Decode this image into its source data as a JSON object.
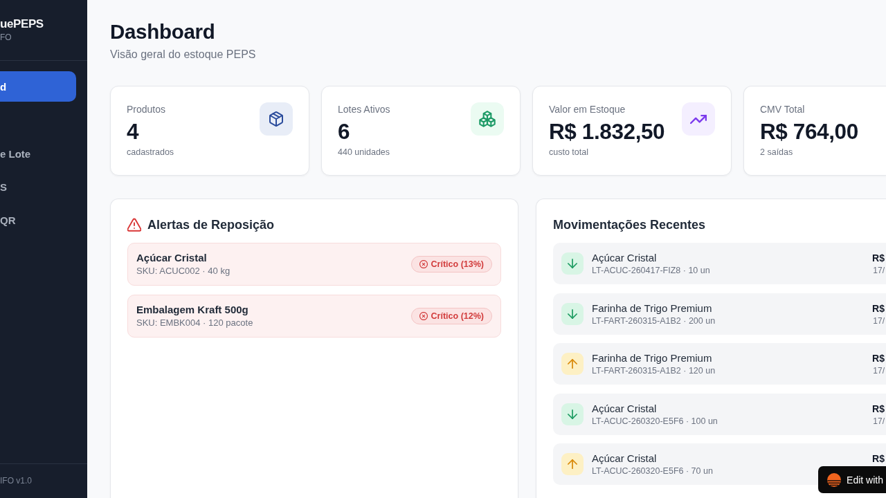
{
  "sidebar": {
    "logo_title": "uePEPS",
    "logo_subtitle": "FO",
    "nav": [
      {
        "label": "d",
        "selected": true
      },
      {
        "label": "e Lote",
        "selected": false
      },
      {
        "label": "S",
        "selected": false
      },
      {
        "label": "QR",
        "selected": false
      }
    ],
    "version": "IFO v1.0"
  },
  "header": {
    "title": "Dashboard",
    "subtitle": "Visão geral do estoque PEPS"
  },
  "stats": [
    {
      "kind": "products",
      "label": "Produtos",
      "value": "4",
      "caption": "cadastrados"
    },
    {
      "kind": "batches",
      "label": "Lotes Ativos",
      "value": "6",
      "caption": "440 unidades"
    },
    {
      "kind": "value",
      "label": "Valor em Estoque",
      "value": "R$ 1.832,50",
      "caption": "custo total"
    },
    {
      "kind": "cost",
      "label": "CMV Total",
      "value": "R$ 764,00",
      "caption": "2 saídas"
    }
  ],
  "alerts": {
    "title": "Alertas de Reposição",
    "items": [
      {
        "name": "Açúcar Cristal",
        "detail": "SKU: ACUC002 · 40 kg",
        "badge": "Crítico (13%)"
      },
      {
        "name": "Embalagem Kraft 500g",
        "detail": "SKU: EMBK004 · 120 pacote",
        "badge": "Crítico (12%)"
      }
    ]
  },
  "movements": {
    "title": "Movimentações Recentes",
    "items": [
      {
        "kind": "in",
        "name": "Açúcar Cristal",
        "detail": "LT-ACUC-260417-FIZ8 · 10 un",
        "amount": "R$",
        "date": "17/"
      },
      {
        "kind": "in",
        "name": "Farinha de Trigo Premium",
        "detail": "LT-FART-260315-A1B2 · 200 un",
        "amount": "R$",
        "date": "17/"
      },
      {
        "kind": "out",
        "name": "Farinha de Trigo Premium",
        "detail": "LT-FART-260315-A1B2 · 120 un",
        "amount": "R$",
        "date": "17/"
      },
      {
        "kind": "in",
        "name": "Açúcar Cristal",
        "detail": "LT-ACUC-260320-E5F6 · 100 un",
        "amount": "R$",
        "date": "17/"
      },
      {
        "kind": "out",
        "name": "Açúcar Cristal",
        "detail": "LT-ACUC-260320-E5F6 · 70 un",
        "amount": "R$"
      }
    ]
  },
  "edit_badge": {
    "label": "Edit with"
  }
}
